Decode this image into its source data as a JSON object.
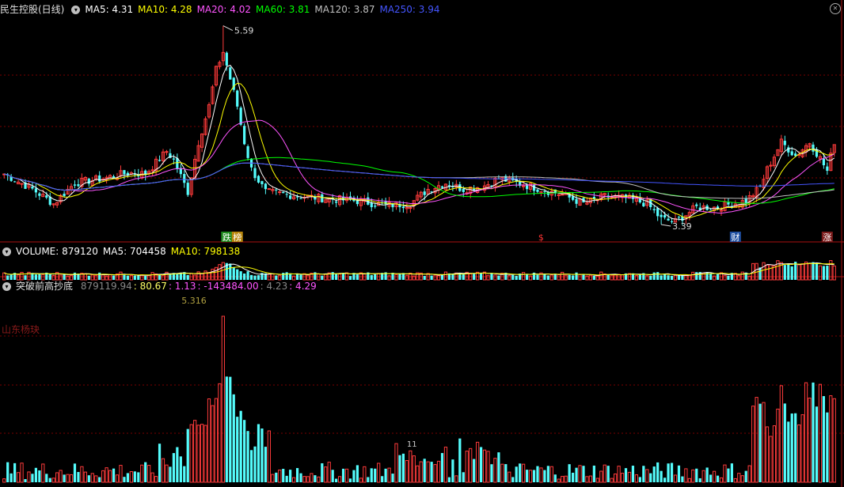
{
  "colors": {
    "up": "#ff3b3b",
    "down": "#54fcfc",
    "ma5": "#ffffff",
    "ma10": "#ffff00",
    "ma20": "#ff55ff",
    "ma60": "#00ff00",
    "ma120": "#c0c0c0",
    "ma250": "#4455ff",
    "grid": "#7a0000",
    "axis": "#aa1111"
  },
  "main": {
    "title": "民生控股(日线)",
    "legend": [
      {
        "label": "MA5:",
        "value": "4.31",
        "color": "#ffffff"
      },
      {
        "label": "MA10:",
        "value": "4.28",
        "color": "#ffff00"
      },
      {
        "label": "MA20:",
        "value": "4.02",
        "color": "#ff55ff"
      },
      {
        "label": "MA60:",
        "value": "3.81",
        "color": "#00ff00"
      },
      {
        "label": "MA120:",
        "value": "3.87",
        "color": "#c0c0c0"
      },
      {
        "label": "MA250:",
        "value": "3.94",
        "color": "#4455ff"
      }
    ],
    "high_label": "5.59",
    "low_label": "3.39",
    "markers": [
      {
        "text": "跌",
        "index": 63,
        "bg": "#1e8a1e",
        "fg": "#ffffff"
      },
      {
        "text": "榜",
        "index": 66,
        "bg": "#b8860b",
        "fg": "#ffffff"
      },
      {
        "text": "$",
        "index": 152,
        "bg": "",
        "fg": "#ff3333"
      },
      {
        "text": "财",
        "index": 207,
        "bg": "#1f4fa0",
        "fg": "#ffffff"
      },
      {
        "text": "涨",
        "index": 233,
        "bg": "#7a1a1a",
        "fg": "#ffffff"
      }
    ]
  },
  "volume": {
    "legend": [
      {
        "label": "VOLUME:",
        "value": "879120",
        "color": "#ffffff"
      },
      {
        "label": "MA5:",
        "value": "704458",
        "color": "#ffffff"
      },
      {
        "label": "MA10:",
        "value": "798138",
        "color": "#ffff00"
      }
    ]
  },
  "indicator": {
    "title": "突破前高抄底",
    "values": [
      {
        "text": "879119.94",
        "color": "#888888"
      },
      {
        "text": "80.67",
        "color": "#ffff66"
      },
      {
        "text": "1.13",
        "color": "#ff55ff"
      },
      {
        "text": "-143484.00",
        "color": "#ff55ff"
      },
      {
        "text": "4.23",
        "color": "#888888"
      },
      {
        "text": "4.29",
        "color": "#ff55ff"
      }
    ],
    "peak_label": "5.316",
    "watermark": "山东杨玦",
    "small_label": "11"
  },
  "chart_data": {
    "type": "candlestick",
    "count": 236,
    "price_range": [
      3.25,
      5.7
    ],
    "volume_range": [
      0,
      1500000
    ],
    "ohlc_keypoints": [
      [
        0,
        3.95
      ],
      [
        8,
        3.78
      ],
      [
        14,
        3.62
      ],
      [
        20,
        3.85
      ],
      [
        28,
        3.9
      ],
      [
        35,
        3.96
      ],
      [
        40,
        3.95
      ],
      [
        46,
        4.2
      ],
      [
        48,
        4.1
      ],
      [
        52,
        3.75
      ],
      [
        55,
        4.3
      ],
      [
        58,
        4.7
      ],
      [
        60,
        5.1
      ],
      [
        62,
        5.3
      ],
      [
        64,
        5.0
      ],
      [
        66,
        4.7
      ],
      [
        68,
        4.3
      ],
      [
        70,
        4.0
      ],
      [
        74,
        3.75
      ],
      [
        80,
        3.72
      ],
      [
        90,
        3.68
      ],
      [
        100,
        3.65
      ],
      [
        108,
        3.6
      ],
      [
        115,
        3.62
      ],
      [
        120,
        3.78
      ],
      [
        125,
        3.85
      ],
      [
        130,
        3.78
      ],
      [
        136,
        3.82
      ],
      [
        140,
        3.9
      ],
      [
        146,
        3.84
      ],
      [
        152,
        3.78
      ],
      [
        158,
        3.72
      ],
      [
        164,
        3.62
      ],
      [
        170,
        3.7
      ],
      [
        176,
        3.68
      ],
      [
        182,
        3.62
      ],
      [
        186,
        3.45
      ],
      [
        190,
        3.42
      ],
      [
        196,
        3.58
      ],
      [
        202,
        3.58
      ],
      [
        206,
        3.62
      ],
      [
        210,
        3.65
      ],
      [
        214,
        3.8
      ],
      [
        216,
        4.0
      ],
      [
        220,
        4.3
      ],
      [
        224,
        4.15
      ],
      [
        228,
        4.3
      ],
      [
        231,
        4.12
      ],
      [
        233,
        3.98
      ],
      [
        235,
        4.31
      ]
    ],
    "ma_final": {
      "MA5": 4.31,
      "MA10": 4.28,
      "MA20": 4.02,
      "MA60": 3.81,
      "MA120": 3.87,
      "MA250": 3.94
    },
    "volume_last": 879120,
    "volume_ma5": 704458,
    "volume_ma10": 798138,
    "indicator_peak": 5.316
  }
}
